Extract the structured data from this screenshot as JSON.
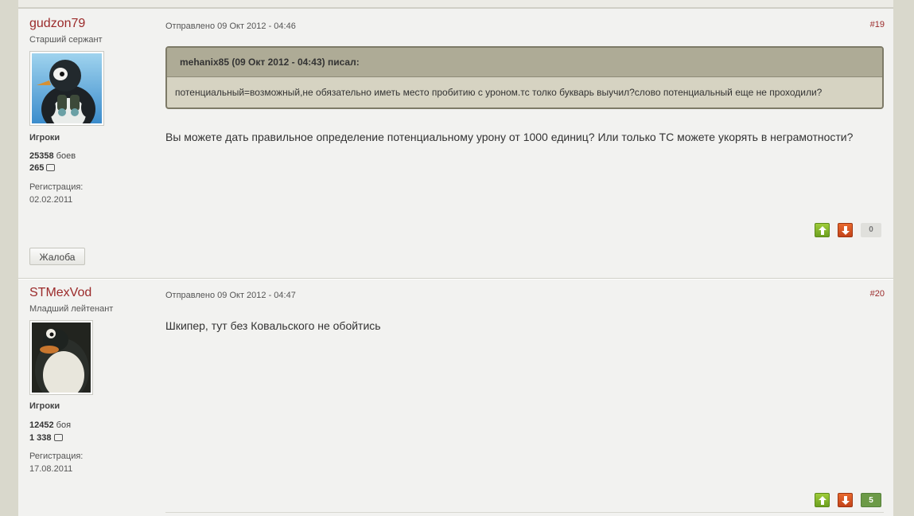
{
  "posts": [
    {
      "author": "gudzon79",
      "rank": "Старший сержант",
      "group": "Игроки",
      "battles_count": "25358",
      "battles_label": "боев",
      "posts_count": "265",
      "reg_label": "Регистрация:",
      "reg_date": "02.02.2011",
      "report_label": "Жалоба",
      "posted": "Отправлено 09 Окт 2012 - 04:46",
      "number": "#19",
      "quote_header": "mehanix85 (09 Окт 2012 - 04:43) писал:",
      "quote_text": "потенциальный=возможный,не обязательно иметь место пробитию с уроном.тс толко букварь выучил?слово потенциальный еще не проходили?",
      "text": "Вы можете дать правильное определение потенциальному урону от 1000 единиц? Или только ТС можете укорять в неграмотности?",
      "reputation": "0"
    },
    {
      "author": "STMexVod",
      "rank": "Младший лейтенант",
      "group": "Игроки",
      "battles_count": "12452",
      "battles_label": "боя",
      "posts_count": "1 338",
      "reg_label": "Регистрация:",
      "reg_date": "17.08.2011",
      "posted": "Отправлено 09 Окт 2012 - 04:47",
      "number": "#20",
      "text": "Шкипер, тут без Ковальского не обойтись",
      "reputation": "5"
    }
  ],
  "icons": {
    "vote_up": "arrow-up-icon",
    "vote_down": "arrow-down-icon",
    "posts": "comment-icon"
  },
  "colors": {
    "author": "#9b2a2a",
    "vote_up": "#7fb32a",
    "vote_down": "#d6531f",
    "rep_positive": "#6c9a47"
  }
}
